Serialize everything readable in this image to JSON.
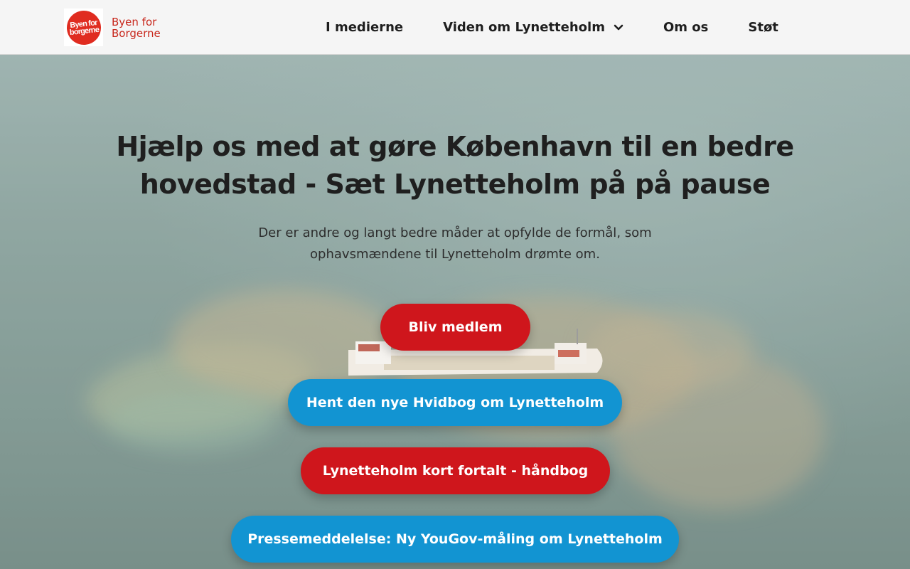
{
  "header": {
    "logo_mark_line1": "Byen for",
    "logo_mark_line2": "borgerne",
    "logo_text_line1": "Byen for",
    "logo_text_line2": "Borgerne",
    "nav": [
      {
        "label": "I medierne"
      },
      {
        "label": "Viden om Lynetteholm",
        "icon": "chevron-down-icon"
      },
      {
        "label": "Om os"
      },
      {
        "label": "Støt"
      }
    ]
  },
  "hero": {
    "title": "Hjælp os med at gøre København til en bedre hovedstad - Sæt Lynetteholm på på pause",
    "subtitle": "Der er andre og langt bedre måder at opfylde de formål, som ophavsmændene til Lynetteholm drømte om.",
    "buttons": [
      {
        "label": "Bliv medlem",
        "color": "#cf161c"
      },
      {
        "label": "Hent den nye Hvidbog om Lynetteholm",
        "color": "#1294d2"
      },
      {
        "label": "Lynetteholm kort fortalt - håndbog",
        "color": "#cf161c"
      },
      {
        "label": "Pressemeddelelse: Ny YouGov-måling om Lynetteholm",
        "color": "#1294d2"
      }
    ]
  },
  "colors": {
    "brand_red": "#cf161c",
    "brand_blue": "#1294d2",
    "logo_red": "#e02c20"
  }
}
